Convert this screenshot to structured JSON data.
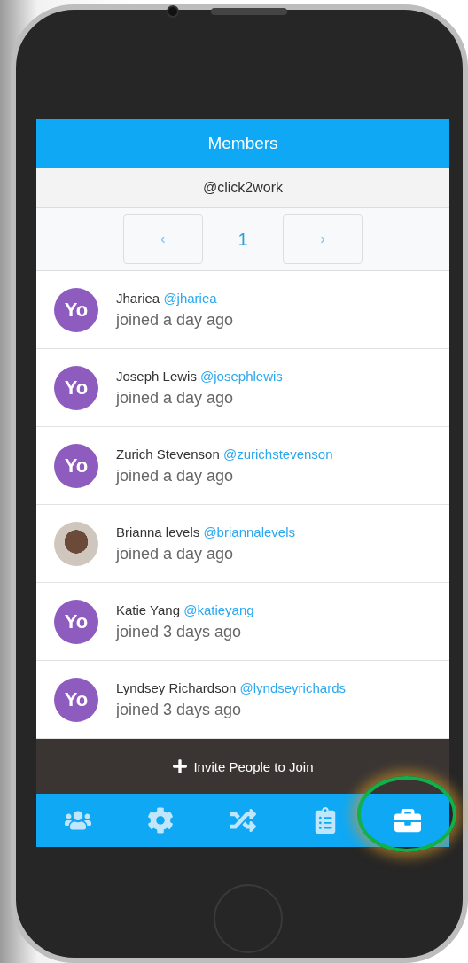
{
  "header": {
    "title": "Members"
  },
  "group": {
    "handle": "@click2work"
  },
  "pager": {
    "prev": "‹",
    "page": "1",
    "next": "›"
  },
  "members": [
    {
      "name": "Jhariea",
      "handle": "@jhariea",
      "joined": "joined a day ago",
      "avatar": {
        "kind": "logo",
        "text": "Yo"
      }
    },
    {
      "name": "Joseph Lewis",
      "handle": "@josephlewis",
      "joined": "joined a day ago",
      "avatar": {
        "kind": "logo",
        "text": "Yo"
      }
    },
    {
      "name": "Zurich Stevenson",
      "handle": "@zurichstevenson",
      "joined": "joined a day ago",
      "avatar": {
        "kind": "logo",
        "text": "Yo"
      }
    },
    {
      "name": "Brianna levels",
      "handle": "@briannalevels",
      "joined": "joined a day ago",
      "avatar": {
        "kind": "photo"
      }
    },
    {
      "name": "Katie Yang",
      "handle": "@katieyang",
      "joined": "joined 3 days ago",
      "avatar": {
        "kind": "logo",
        "text": "Yo"
      }
    },
    {
      "name": "Lyndsey Richardson",
      "handle": "@lyndseyrichards",
      "joined": "joined 3 days ago",
      "avatar": {
        "kind": "logo",
        "text": "Yo"
      }
    }
  ],
  "invite": {
    "label": "Invite People to Join"
  },
  "nav": [
    {
      "kind": "people",
      "selected": false
    },
    {
      "kind": "settings",
      "selected": false
    },
    {
      "kind": "shuffle",
      "selected": false
    },
    {
      "kind": "clipboard",
      "selected": false
    },
    {
      "kind": "briefcase",
      "selected": true,
      "highlighted": true
    }
  ]
}
